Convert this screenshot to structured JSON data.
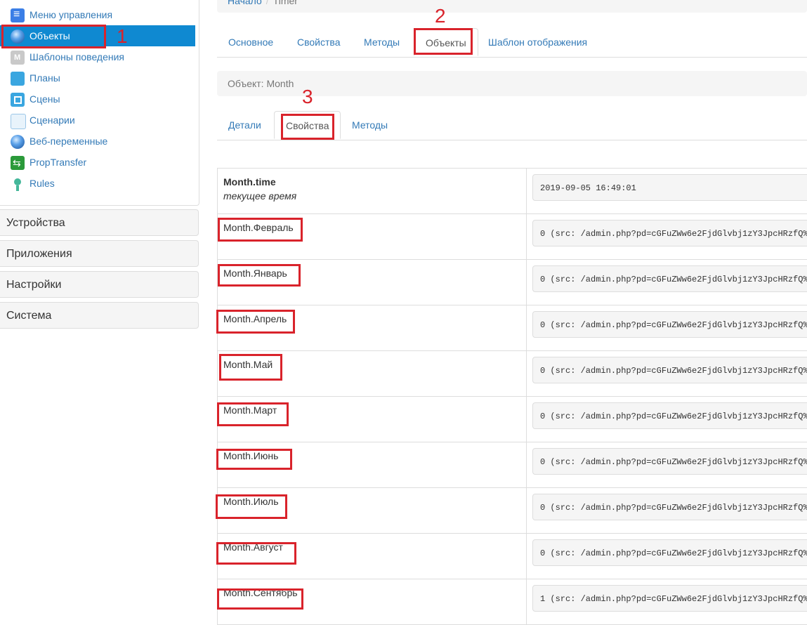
{
  "sidebar": {
    "items": [
      {
        "label": "Меню управления",
        "icon": "menu-icon"
      },
      {
        "label": "Объекты",
        "icon": "globe-icon"
      },
      {
        "label": "Шаблоны поведения",
        "icon": "template-icon"
      },
      {
        "label": "Планы",
        "icon": "plans-icon"
      },
      {
        "label": "Сцены",
        "icon": "scenes-icon"
      },
      {
        "label": "Сценарии",
        "icon": "scenarios-icon"
      },
      {
        "label": "Веб-переменные",
        "icon": "globe-icon"
      },
      {
        "label": "PropTransfer",
        "icon": "transfer-icon"
      },
      {
        "label": "Rules",
        "icon": "robot-icon"
      }
    ],
    "groups": [
      "Устройства",
      "Приложения",
      "Настройки",
      "Система"
    ]
  },
  "breadcrumb": {
    "home": "Начало",
    "current": "Timer"
  },
  "tabs": [
    "Основное",
    "Свойства",
    "Методы",
    "Объекты",
    "Шаблон отображения"
  ],
  "object_header": "Объект: Month",
  "subtabs": [
    "Детали",
    "Свойства",
    "Методы"
  ],
  "properties": [
    {
      "name": "Month.time",
      "description": "текущее время",
      "value": "2019-09-05 16:49:01"
    },
    {
      "name": "Month.Февраль",
      "value": "0 (src: /admin.php?pd=cGFuZWw6e2FjdGlvbj1zY3JpcHRzfQ%"
    },
    {
      "name": "Month.Январь",
      "value": "0 (src: /admin.php?pd=cGFuZWw6e2FjdGlvbj1zY3JpcHRzfQ%"
    },
    {
      "name": "Month.Апрель",
      "value": "0 (src: /admin.php?pd=cGFuZWw6e2FjdGlvbj1zY3JpcHRzfQ%"
    },
    {
      "name": "Month.Май",
      "value": "0 (src: /admin.php?pd=cGFuZWw6e2FjdGlvbj1zY3JpcHRzfQ%"
    },
    {
      "name": "Month.Март",
      "value": "0 (src: /admin.php?pd=cGFuZWw6e2FjdGlvbj1zY3JpcHRzfQ%"
    },
    {
      "name": "Month.Июнь",
      "value": "0 (src: /admin.php?pd=cGFuZWw6e2FjdGlvbj1zY3JpcHRzfQ%"
    },
    {
      "name": "Month.Июль",
      "value": "0 (src: /admin.php?pd=cGFuZWw6e2FjdGlvbj1zY3JpcHRzfQ%"
    },
    {
      "name": "Month.Август",
      "value": "0 (src: /admin.php?pd=cGFuZWw6e2FjdGlvbj1zY3JpcHRzfQ%"
    },
    {
      "name": "Month.Сентябрь",
      "value": "1 (src: /admin.php?pd=cGFuZWw6e2FjdGlvbj1zY3JpcHRzfQ%"
    }
  ],
  "annotations": [
    "1",
    "2",
    "3"
  ],
  "colors": {
    "link": "#337ab7",
    "active_bg": "#0f89d1",
    "annotation": "#d9232b"
  }
}
